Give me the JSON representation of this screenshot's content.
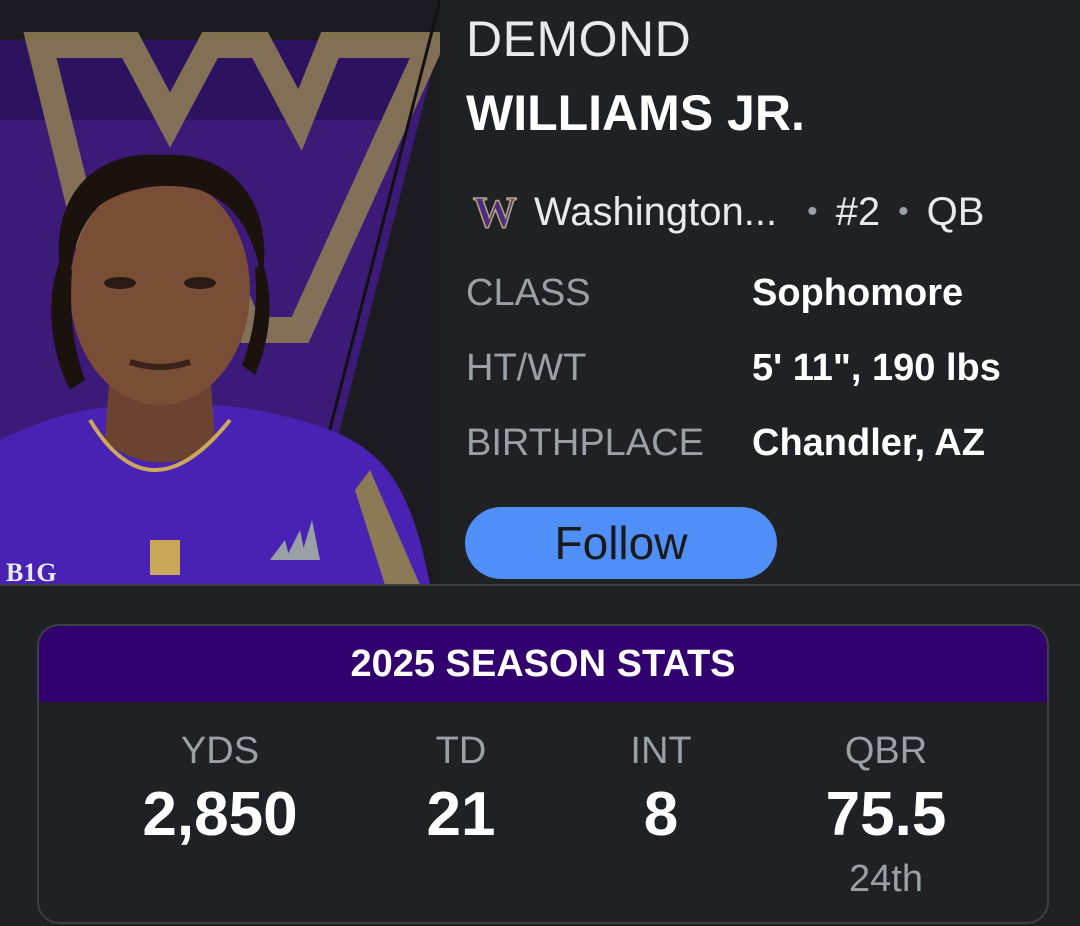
{
  "player": {
    "first_name": "DEMOND",
    "last_name": "WILLIAMS JR.",
    "team": "Washington...",
    "number": "#2",
    "position": "QB",
    "separator": "•",
    "team_logo_text": "W",
    "photo_badge_text": "B1G"
  },
  "info": [
    {
      "label": "CLASS",
      "value": "Sophomore"
    },
    {
      "label": "HT/WT",
      "value": "5' 11\", 190 lbs"
    },
    {
      "label": "BIRTHPLACE",
      "value": "Chandler, AZ"
    }
  ],
  "follow_label": "Follow",
  "stats": {
    "title": "2025 SEASON STATS",
    "items": [
      {
        "label": "YDS",
        "value": "2,850",
        "rank": ""
      },
      {
        "label": "TD",
        "value": "21",
        "rank": ""
      },
      {
        "label": "INT",
        "value": "8",
        "rank": ""
      },
      {
        "label": "QBR",
        "value": "75.5",
        "rank": "24th"
      }
    ]
  },
  "colors": {
    "background": "#202124",
    "accent_purple": "#32006e",
    "follow_button": "#4f8ff7",
    "gold": "#b7a57a"
  }
}
